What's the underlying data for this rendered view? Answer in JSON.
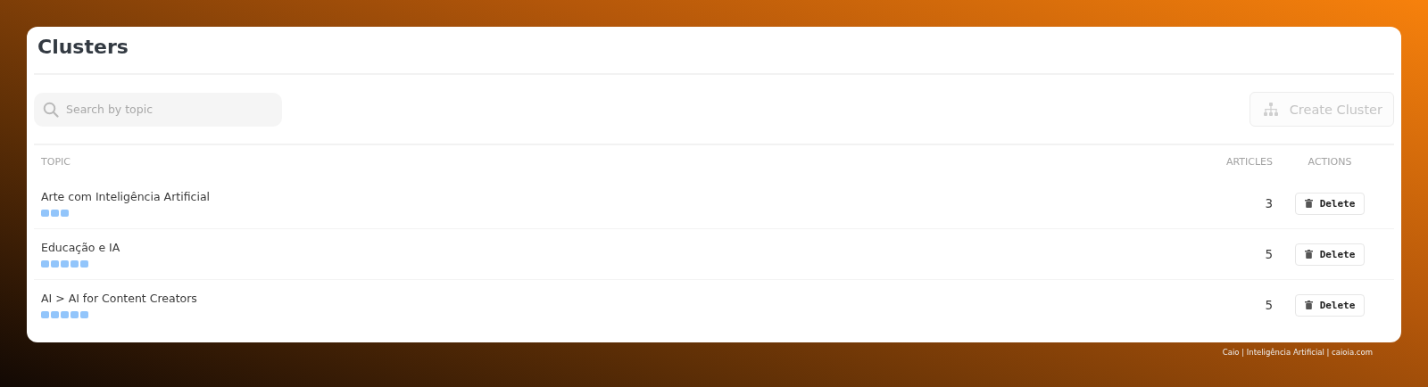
{
  "page": {
    "title": "Clusters"
  },
  "search": {
    "placeholder": "Search by topic"
  },
  "create_button": {
    "label": "Create Cluster",
    "disabled": true
  },
  "table": {
    "columns": [
      "TOPIC",
      "ARTICLES",
      "ACTIONS"
    ],
    "rows": [
      {
        "topic": "Arte com Inteligência Artificial",
        "articles": "3",
        "action": "Delete"
      },
      {
        "topic": "Educação e IA",
        "articles": "5",
        "action": "Delete"
      },
      {
        "topic": "AI > AI for Content Creators",
        "articles": "5",
        "action": "Delete"
      }
    ]
  },
  "footer": "Caio | Inteligência Artificial | caioia.com"
}
